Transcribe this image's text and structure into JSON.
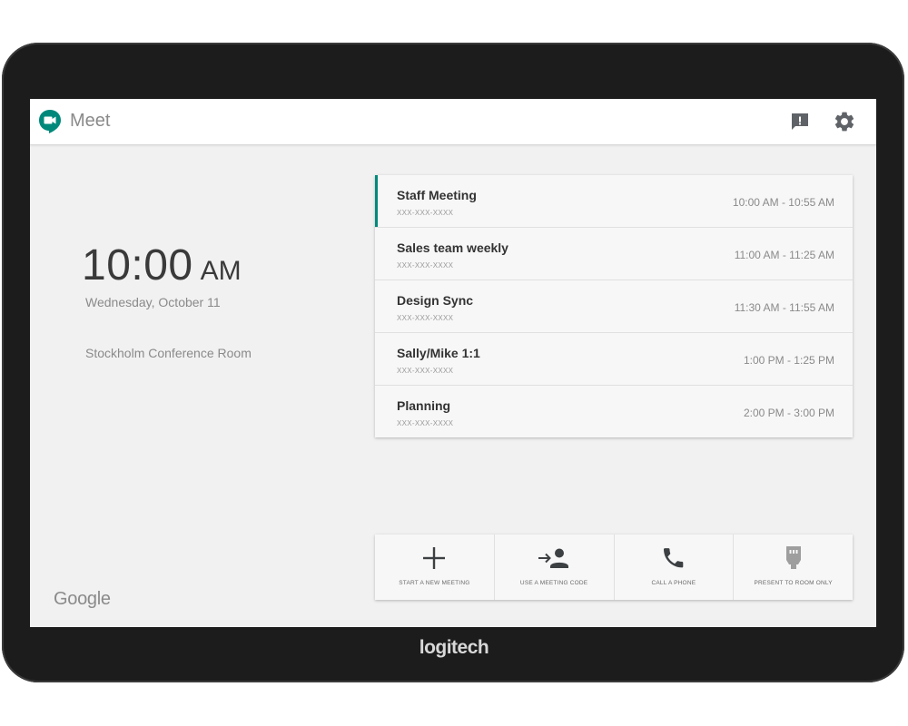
{
  "app": {
    "name": "Meet",
    "accent_color": "#00897b",
    "logo_icon": "meet-logo-icon",
    "feedback_icon": "feedback-icon",
    "settings_icon": "gear-icon"
  },
  "clock": {
    "time": "10:00",
    "ampm": "AM",
    "date": "Wednesday, October 11",
    "room": "Stockholm Conference Room"
  },
  "footer": {
    "google": "Google"
  },
  "meetings": [
    {
      "title": "Staff Meeting",
      "code": "XXX-XXX-XXXX",
      "time": "10:00 AM - 10:55 AM",
      "active": true
    },
    {
      "title": "Sales team weekly",
      "code": "XXX-XXX-XXXX",
      "time": "11:00 AM - 11:25 AM",
      "active": false
    },
    {
      "title": "Design Sync",
      "code": "XXX-XXX-XXXX",
      "time": "11:30 AM - 11:55 AM",
      "active": false
    },
    {
      "title": "Sally/Mike 1:1",
      "code": "XXX-XXX-XXXX",
      "time": "1:00 PM - 1:25 PM",
      "active": false
    },
    {
      "title": "Planning",
      "code": "XXX-XXX-XXXX",
      "time": "2:00 PM - 3:00 PM",
      "active": false
    }
  ],
  "actions": [
    {
      "label": "START A NEW MEETING",
      "icon": "plus-icon"
    },
    {
      "label": "USE A MEETING CODE",
      "icon": "join-person-icon"
    },
    {
      "label": "CALL A PHONE",
      "icon": "phone-icon"
    },
    {
      "label": "PRESENT TO ROOM ONLY",
      "icon": "hdmi-icon"
    }
  ],
  "device": {
    "brand": "logitech"
  }
}
